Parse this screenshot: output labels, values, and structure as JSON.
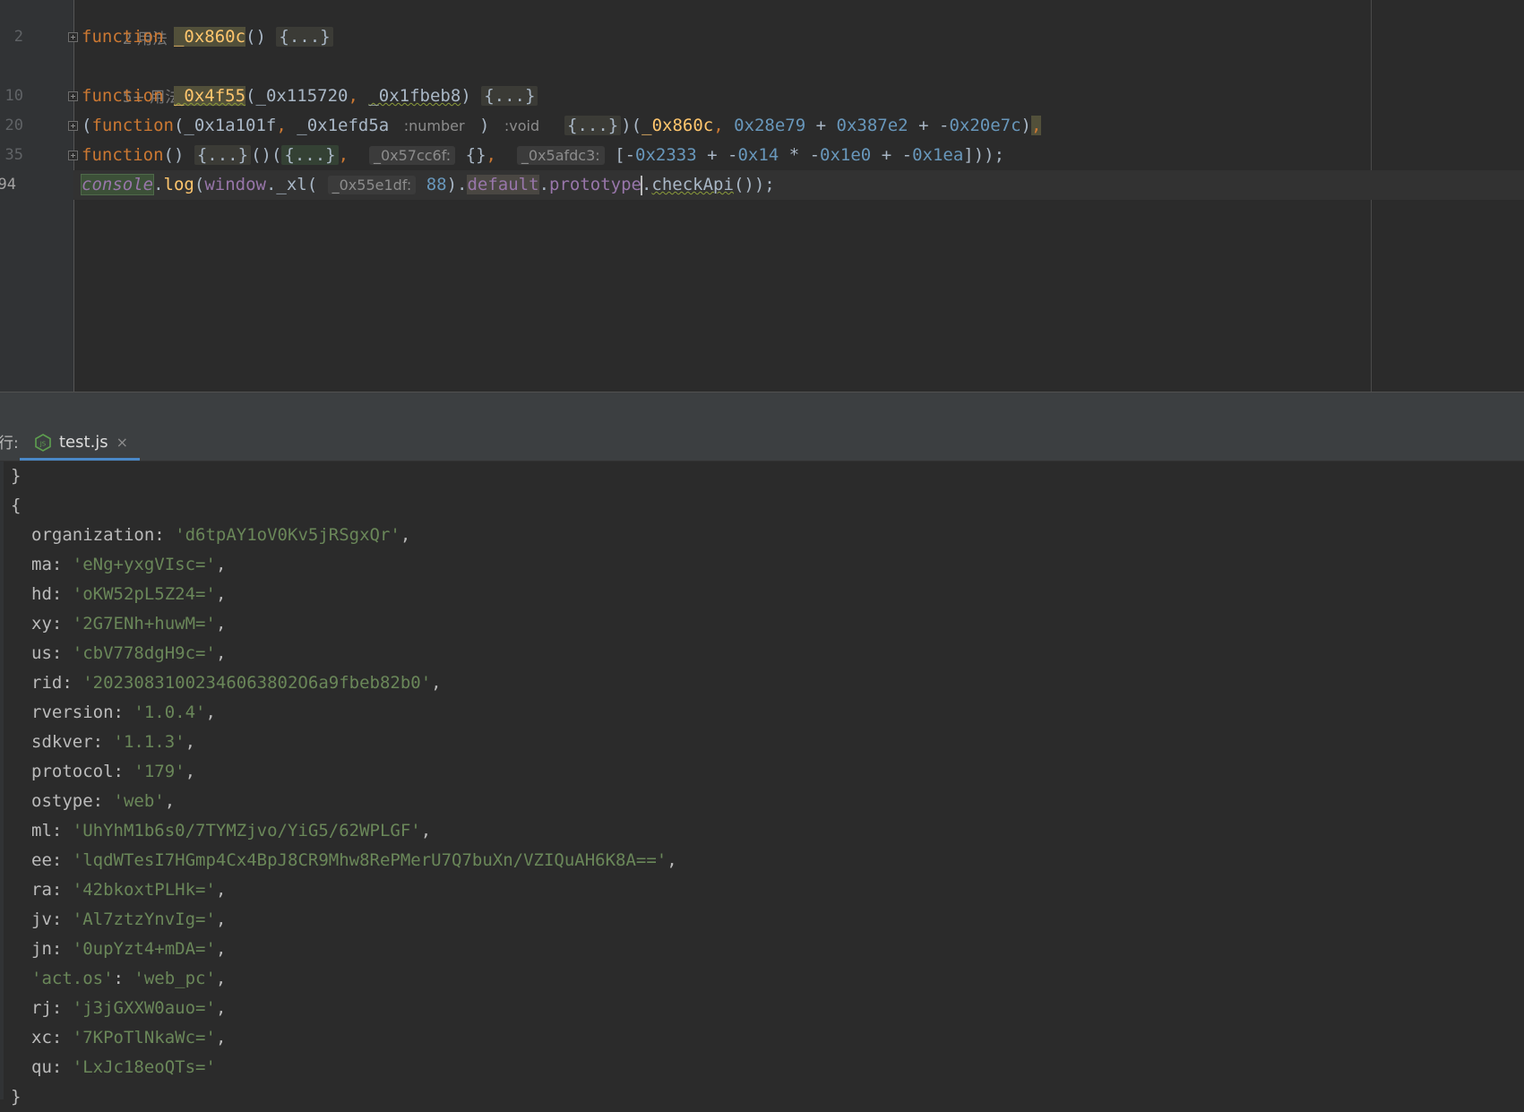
{
  "editor": {
    "line_numbers": [
      "2",
      "10",
      "20",
      "35",
      "94"
    ],
    "usage_hints": [
      "2 用法",
      "5+ 用法"
    ],
    "line1": {
      "keyword": "function",
      "name": "_0x860c",
      "parens": "()",
      "folded": "{...}"
    },
    "line2": {
      "keyword": "function",
      "name": "_0x4f55",
      "open": "(",
      "p1": "_0x115720",
      "comma": ",",
      "p2": "_0x1fbeb8",
      "close": ")",
      "folded": "{...}"
    },
    "line3": {
      "open": "(",
      "keyword": "function",
      "sig_open": "(",
      "p1": "_0x1a101f",
      "comma": ",",
      "p2": "_0x1efd5a",
      "type_hint": ":number",
      "sig_close": ")",
      "return_hint": ":void",
      "folded": "{...}",
      "call_open": ")(",
      "arg": "_0x860c",
      "arg_comma": ",",
      "n1": "0x28e79",
      "plus1": "+",
      "n2": "0x387e2",
      "plus2": "+",
      "minus": "-",
      "n3": "0x20e7c",
      "close": ")",
      "trail": ","
    },
    "line4": {
      "keyword": "function",
      "parens": "()",
      "folded1": "{...}",
      "mid": "()(",
      "folded2": "{...}",
      "comma1": ",",
      "hint1": "_0x57cc6f:",
      "obj": "{}",
      "comma2": ",",
      "hint2": "_0x5afdc3:",
      "arr_open": "[",
      "m1": "-",
      "a1": "0x2333",
      "plus1": "+",
      "m2": "-",
      "a2": "0x14",
      "times": "*",
      "m3": "-",
      "a3": "0x1e0",
      "plus2": "+",
      "m4": "-",
      "a4": "0x1ea",
      "arr_close": "]));"
    },
    "line5": {
      "console": "console",
      "dot": ".",
      "log": "log",
      "paren": "(",
      "window": "window",
      "xl": "._xl(",
      "hint": "_0x55e1df:",
      "arg": "88",
      "close1": ").",
      "default": "default",
      "dot2": ".",
      "prototype": "prototype",
      "dot3": ".",
      "checkapi": "checkApi",
      "end": "());"
    }
  },
  "run_panel": {
    "prefix": "行:",
    "tab_label": "test.js",
    "tab_close": "×",
    "icon": "nodejs-icon"
  },
  "console_output": {
    "close_prev": "}",
    "open_brace": "{",
    "entries": [
      {
        "key": "organization",
        "value": "'d6tpAY1oV0Kv5jRSgxQr'",
        "sep": ","
      },
      {
        "key": "ma",
        "value": "'eNg+yxgVIsc='",
        "sep": ","
      },
      {
        "key": "hd",
        "value": "'oKW52pL5Z24='",
        "sep": ","
      },
      {
        "key": "xy",
        "value": "'2G7ENh+huwM='",
        "sep": ","
      },
      {
        "key": "us",
        "value": "'cbV778dgH9c='",
        "sep": ","
      },
      {
        "key": "rid",
        "value": "'20230831002346063802O6a9fbeb82b0'",
        "sep": ","
      },
      {
        "key": "rversion",
        "value": "'1.0.4'",
        "sep": ","
      },
      {
        "key": "sdkver",
        "value": "'1.1.3'",
        "sep": ","
      },
      {
        "key": "protocol",
        "value": "'179'",
        "sep": ","
      },
      {
        "key": "ostype",
        "value": "'web'",
        "sep": ","
      },
      {
        "key": "ml",
        "value": "'UhYhM1b6s0/7TYMZjvo/YiG5/62WPLGF'",
        "sep": ","
      },
      {
        "key": "ee",
        "value": "'lqdWTesI7HGmp4Cx4BpJ8CR9Mhw8RePMerU7Q7buXn/VZIQuAH6K8A=='",
        "sep": ","
      },
      {
        "key": "ra",
        "value": "'42bkoxtPLHk='",
        "sep": ","
      },
      {
        "key": "jv",
        "value": "'Al7ztzYnvIg='",
        "sep": ","
      },
      {
        "key": "jn",
        "value": "'0upYzt4+mDA='",
        "sep": ","
      },
      {
        "key": "'act.os'",
        "value": "'web_pc'",
        "sep": ","
      },
      {
        "key": "rj",
        "value": "'j3jGXXW0auo='",
        "sep": ","
      },
      {
        "key": "xc",
        "value": "'7KPoTlNkaWc='",
        "sep": ","
      },
      {
        "key": "qu",
        "value": "'LxJc18eoQTs='",
        "sep": ""
      }
    ],
    "close_brace": "}"
  }
}
